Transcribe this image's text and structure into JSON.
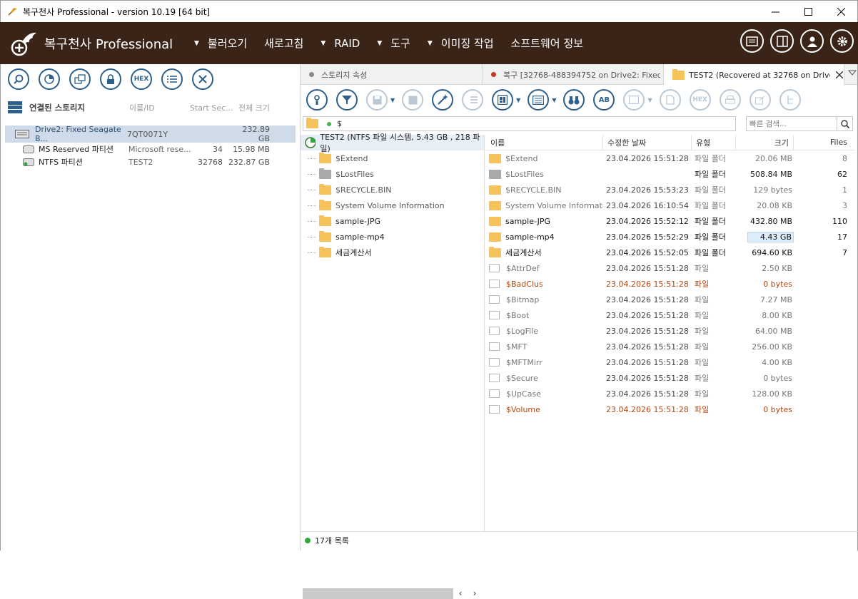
{
  "window": {
    "title": "복구천사 Professional - version 10.19 [64 bit]"
  },
  "brand": {
    "name": "복구천사 Professional"
  },
  "menu": {
    "items": [
      "불러오기",
      "새로고침",
      "RAID",
      "도구",
      "이미징 작업",
      "소프트웨어 정보"
    ]
  },
  "left": {
    "toolbar": {
      "hex_label": "HEX"
    },
    "header": {
      "title": "연결된 스토리지",
      "col_id": "이름/ID",
      "col_start": "Start Sec...",
      "col_size": "전체 크기"
    },
    "rows": [
      {
        "name": "Drive2: Fixed Seagate B...",
        "id": "7QT0071Y",
        "start": "",
        "size": "232.89 GB"
      },
      {
        "name": "MS Reserved 파티션",
        "id": "Microsoft rese...",
        "start": "34",
        "size": "15.98 MB"
      },
      {
        "name": "NTFS 파티션",
        "id": "TEST2",
        "start": "32768",
        "size": "232.87 GB"
      }
    ]
  },
  "tabs": [
    {
      "label": "스토리지 속성",
      "dot": "#888888"
    },
    {
      "label": "복구 [32768-488394752 on Drive2: Fixed ...",
      "dot": "#c0392b"
    },
    {
      "label": "TEST2 (Recovered at 32768 on Drive..."
    }
  ],
  "toolbar": {
    "hex_label": "HEX",
    "ab_label": "AB"
  },
  "path": {
    "value": "$"
  },
  "search": {
    "placeholder": "빠른 검색..."
  },
  "tree": {
    "root": "TEST2 (NTFS 파일 시스템, 5.43 GB , 218 파일)",
    "items": [
      "$Extend",
      "$LostFiles",
      "$RECYCLE.BIN",
      "System Volume Information",
      "sample-JPG",
      "sample-mp4",
      "세금계산서"
    ]
  },
  "list": {
    "headers": {
      "name": "이름",
      "date": "수정한 날짜",
      "type": "유형",
      "size": "크기",
      "files": "Files"
    },
    "rows": [
      {
        "name": "$Extend",
        "date": "23.04.2026 15:51:28",
        "type": "파일 폴더",
        "size": "20.06 MB",
        "files": "8"
      },
      {
        "name": "$LostFiles",
        "date": "",
        "type": "파일 폴더",
        "size": "508.84 MB",
        "files": "62"
      },
      {
        "name": "$RECYCLE.BIN",
        "date": "23.04.2026 15:53:23",
        "type": "파일 폴더",
        "size": "129 bytes",
        "files": "1"
      },
      {
        "name": "System Volume Informati...",
        "date": "23.04.2026 16:10:54",
        "type": "파일 폴더",
        "size": "20.08 KB",
        "files": "3"
      },
      {
        "name": "sample-JPG",
        "date": "23.04.2026 15:52:12",
        "type": "파일 폴더",
        "size": "432.80 MB",
        "files": "110"
      },
      {
        "name": "sample-mp4",
        "date": "23.04.2026 15:52:29",
        "type": "파일 폴더",
        "size": "4.43 GB",
        "files": "17"
      },
      {
        "name": "세금계산서",
        "date": "23.04.2026 15:52:05",
        "type": "파일 폴더",
        "size": "694.60 KB",
        "files": "7"
      },
      {
        "name": "$AttrDef",
        "date": "23.04.2026 15:51:28",
        "type": "파일",
        "size": "2.50 KB",
        "files": ""
      },
      {
        "name": "$BadClus",
        "date": "23.04.2026 15:51:28",
        "type": "파일",
        "size": "0 bytes",
        "files": ""
      },
      {
        "name": "$Bitmap",
        "date": "23.04.2026 15:51:28",
        "type": "파일",
        "size": "7.27 MB",
        "files": ""
      },
      {
        "name": "$Boot",
        "date": "23.04.2026 15:51:28",
        "type": "파일",
        "size": "8.00 KB",
        "files": ""
      },
      {
        "name": "$LogFile",
        "date": "23.04.2026 15:51:28",
        "type": "파일",
        "size": "64.00 MB",
        "files": ""
      },
      {
        "name": "$MFT",
        "date": "23.04.2026 15:51:28",
        "type": "파일",
        "size": "256.00 KB",
        "files": ""
      },
      {
        "name": "$MFTMirr",
        "date": "23.04.2026 15:51:28",
        "type": "파일",
        "size": "4.00 KB",
        "files": ""
      },
      {
        "name": "$Secure",
        "date": "23.04.2026 15:51:28",
        "type": "파일",
        "size": "0 bytes",
        "files": ""
      },
      {
        "name": "$UpCase",
        "date": "23.04.2026 15:51:28",
        "type": "파일",
        "size": "128.00 KB",
        "files": ""
      },
      {
        "name": "$Volume",
        "date": "23.04.2026 15:51:28",
        "type": "파일",
        "size": "0 bytes",
        "files": ""
      }
    ]
  },
  "status": {
    "text": "17개 목록"
  },
  "colors": {
    "menubar": "#3a2418",
    "accent": "#2c5f8c",
    "deleted": "#b4470f"
  }
}
